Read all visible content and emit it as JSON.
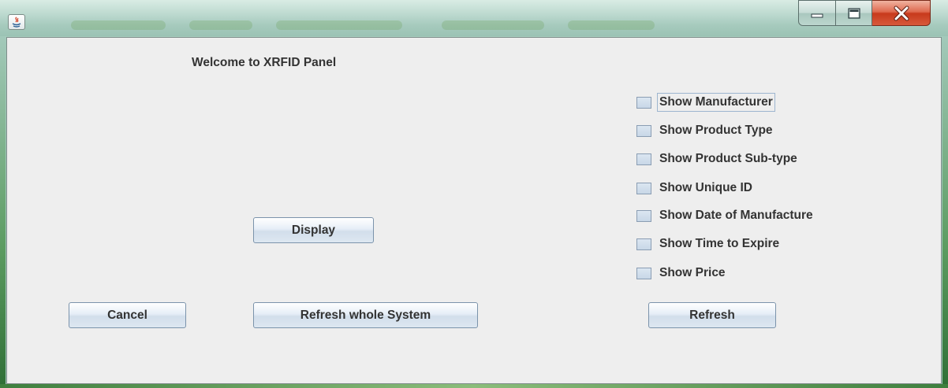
{
  "window": {
    "title": "",
    "controls": {
      "minimize": "minimize-icon",
      "maximize": "maximize-icon",
      "close": "close-icon"
    }
  },
  "panel": {
    "welcome": "Welcome to XRFID Panel",
    "display_label": "Display",
    "cancel_label": "Cancel",
    "refresh_system_label": "Refresh whole System",
    "refresh_label": "Refresh"
  },
  "options": [
    {
      "label": "Show Manufacturer",
      "checked": false
    },
    {
      "label": "Show Product Type",
      "checked": false
    },
    {
      "label": "Show Product Sub-type",
      "checked": false
    },
    {
      "label": "Show Unique ID",
      "checked": false
    },
    {
      "label": "Show Date of Manufacture",
      "checked": false
    },
    {
      "label": "Show Time to Expire",
      "checked": false
    },
    {
      "label": "Show Price",
      "checked": false
    }
  ],
  "colors": {
    "panel_bg": "#eeeeee",
    "text": "#333333",
    "close_button": "#c73a1c"
  }
}
